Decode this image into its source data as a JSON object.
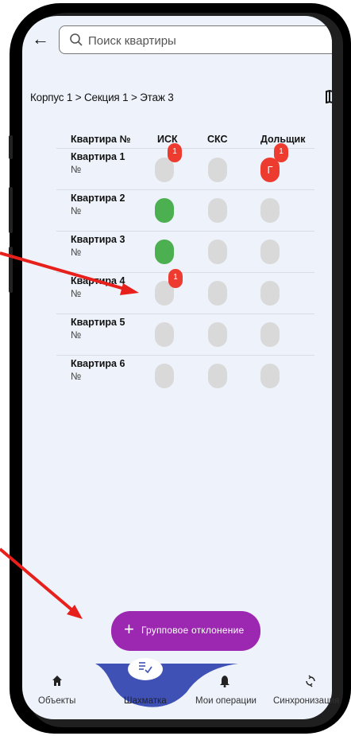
{
  "search": {
    "placeholder": "Поиск квартиры"
  },
  "breadcrumb": "Корпус 1 > Секция 1 > Этаж 3",
  "columns": [
    "Квартира №",
    "ИСК",
    "СКС",
    "Дольщик"
  ],
  "apartments": [
    {
      "name": "Квартира 1",
      "no": "№"
    },
    {
      "name": "Квартира 2",
      "no": "№"
    },
    {
      "name": "Квартира 3",
      "no": "№"
    },
    {
      "name": "Квартира 4",
      "no": "№"
    },
    {
      "name": "Квартира 5",
      "no": "№"
    },
    {
      "name": "Квартира 6",
      "no": "№"
    }
  ],
  "status_marks": {
    "apt1_dolshchik_letter": "Г",
    "badge_count": "1"
  },
  "fab": {
    "label": "Групповое отклонение"
  },
  "nav": [
    "Объекты",
    "Шахматка",
    "Мои операции",
    "Синхронизация"
  ],
  "colors": {
    "accent_purple": "#9c27b0",
    "status_green": "#4caf50",
    "status_red": "#ee3b30",
    "status_grey": "#d9d9d9",
    "nav_blue": "#3f51b5",
    "annotation_arrow": "#e8201c"
  },
  "icons": {
    "back": "arrow-left-icon",
    "search": "magnifier-icon",
    "map": "map-icon",
    "fab": "plus-icon",
    "nav": [
      "home-icon",
      "list-check-icon",
      "bell-icon",
      "sync-icon"
    ]
  }
}
